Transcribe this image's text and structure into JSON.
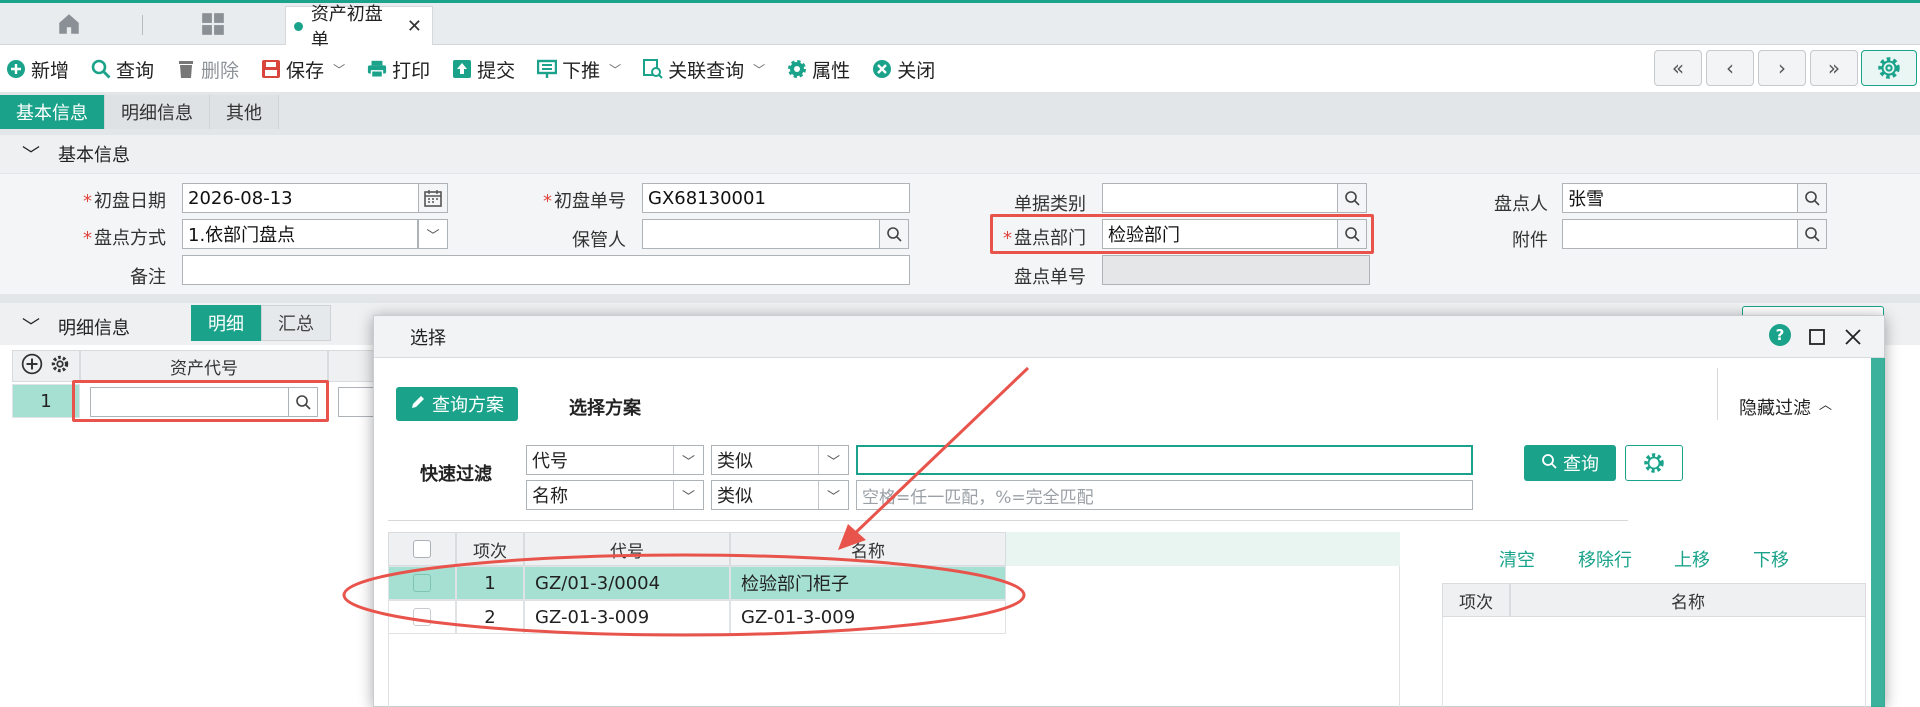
{
  "tabs": {
    "doc_tab_label": "资产初盘单",
    "close": "✕"
  },
  "toolbar": {
    "items": [
      "新增",
      "查询",
      "删除",
      "保存",
      "打印",
      "提交",
      "下推",
      "关联查询",
      "属性",
      "关闭"
    ]
  },
  "nav_buttons": [
    "«",
    "‹",
    "›",
    "»"
  ],
  "section_tabs": [
    "基本信息",
    "明细信息",
    "其他"
  ],
  "basic": {
    "header": "基本信息",
    "date_label": "初盘日期",
    "date_value": "2026-08-13",
    "no_label": "初盘单号",
    "no_value": "GX68130001",
    "type_label": "单据类别",
    "type_value": "",
    "counter_label": "盘点人",
    "counter_value": "张雪",
    "method_label": "盘点方式",
    "method_value": "1.依部门盘点",
    "keeper_label": "保管人",
    "keeper_value": "",
    "dept_label": "盘点部门",
    "dept_value": "检验部门",
    "attach_label": "附件",
    "attach_value": "",
    "note_label": "备注",
    "note_value": "",
    "count_no_label": "盘点单号",
    "count_no_value": ""
  },
  "detail": {
    "header": "明细信息",
    "seg": [
      "明细",
      "汇总"
    ],
    "col_asset_code": "资产代号",
    "row_no": "1"
  },
  "modal": {
    "title": "选择",
    "help": "?",
    "query_scheme": "查询方案",
    "select_scheme": "选择方案",
    "hide_filter": "隐藏过滤",
    "quick_filter": "快速过滤",
    "filter1_field": "代号",
    "filter1_op": "类似",
    "filter1_value": "",
    "filter2_field": "名称",
    "filter2_op": "类似",
    "filter2_placeholder": "空格=任一匹配，%=完全匹配",
    "query_btn": "查询",
    "grid_headers": [
      "项次",
      "代号",
      "名称"
    ],
    "rows": [
      {
        "no": "1",
        "code": "GZ/01-3/0004",
        "name": "检验部门柜子"
      },
      {
        "no": "2",
        "code": "GZ-01-3-009",
        "name": "GZ-01-3-009"
      }
    ],
    "right_actions": [
      "清空",
      "移除行",
      "上移",
      "下移"
    ],
    "right_headers": [
      "项次",
      "名称"
    ]
  },
  "colors": {
    "accent": "#1aa38a",
    "annotation": "#e8544c",
    "selected_row": "#a5e0d2"
  }
}
